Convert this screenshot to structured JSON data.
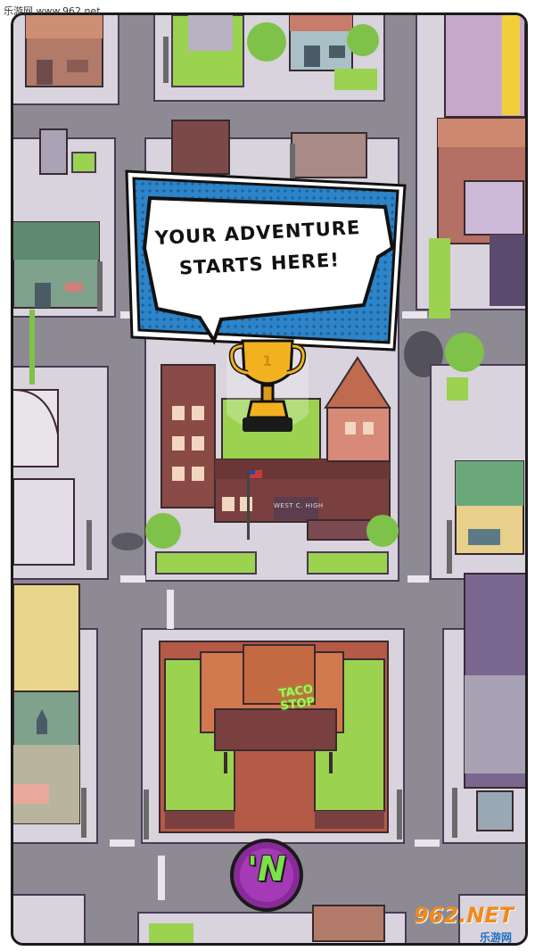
{
  "watermark": {
    "top_text": "乐游网 www.962.net",
    "bottom_logo": "962.NET",
    "bottom_sub": "乐游网"
  },
  "speech_bubble": {
    "text": "YOUR ADVENTURE STARTS HERE!"
  },
  "school": {
    "sign": "WEST C. HIGH"
  },
  "taco_shop": {
    "sign": "TACO STOP"
  },
  "nav_button": {
    "letter": "'N"
  },
  "colors": {
    "road": "#8d8a93",
    "sidewalk": "#d8d3dc",
    "lawn": "#9bd24f",
    "brick": "#8a4a45",
    "bubble_blue": "#2d84c8",
    "trophy_gold": "#f2b21f",
    "button_purple": "#8a2a9a",
    "button_green": "#7be04a"
  },
  "icons": {
    "trophy": "trophy-icon",
    "flag": "flag-icon",
    "n_logo": "n-logo-icon"
  }
}
